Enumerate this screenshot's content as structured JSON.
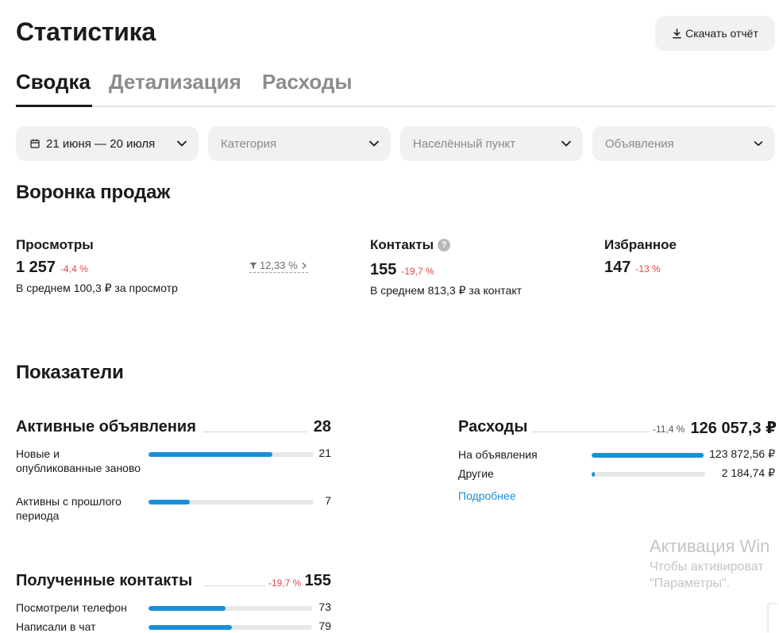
{
  "header": {
    "title": "Статистика",
    "download_label": "Скачать отчёт"
  },
  "tabs": [
    {
      "label": "Сводка",
      "active": true
    },
    {
      "label": "Детализация",
      "active": false
    },
    {
      "label": "Расходы",
      "active": false
    }
  ],
  "filters": {
    "date": "21 июня — 20 июля",
    "category_placeholder": "Категория",
    "location_placeholder": "Населённый пункт",
    "ads_placeholder": "Объявления"
  },
  "funnel": {
    "title": "Воронка продаж",
    "views": {
      "label": "Просмотры",
      "value": "1 257",
      "delta": "-4,4 %",
      "sub": "В среднем 100,3 ₽ за просмотр",
      "conversion": "12,33 %"
    },
    "contacts": {
      "label": "Контакты",
      "help": "?",
      "value": "155",
      "delta": "-19,7 %",
      "sub": "В среднем 813,3 ₽ за контакт"
    },
    "favorites": {
      "label": "Избранное",
      "value": "147",
      "delta": "-13 %"
    }
  },
  "indicators": {
    "title": "Показатели",
    "active_ads": {
      "title": "Активные объявления",
      "total": "28",
      "rows": [
        {
          "label": "Новые и опубликованные заново",
          "value": "21",
          "fraction": 0.75
        },
        {
          "label": "Активны с прошлого периода",
          "value": "7",
          "fraction": 0.25
        }
      ]
    },
    "expenses": {
      "title": "Расходы",
      "delta": "-11,4 %",
      "total": "126 057,3 ₽",
      "rows": [
        {
          "label": "На объявления",
          "value": "123 872,56 ₽",
          "fraction": 0.983
        },
        {
          "label": "Другие",
          "value": "2 184,74 ₽",
          "fraction": 0.017
        }
      ],
      "more_label": "Подробнее"
    },
    "contacts_received": {
      "title": "Полученные контакты",
      "delta": "-19,7 %",
      "total": "155",
      "rows": [
        {
          "label": "Посмотрели телефон",
          "value": "73",
          "fraction": 0.47
        },
        {
          "label": "Написали в чат",
          "value": "79",
          "fraction": 0.51
        }
      ]
    }
  },
  "watermark": {
    "line1": "Активация Win",
    "line2": "Чтобы активироват",
    "line3": "\"Параметры\"."
  },
  "colors": {
    "accent": "#1a8fd8",
    "negative": "#e64545",
    "chip_bg": "#f2f1ef"
  }
}
